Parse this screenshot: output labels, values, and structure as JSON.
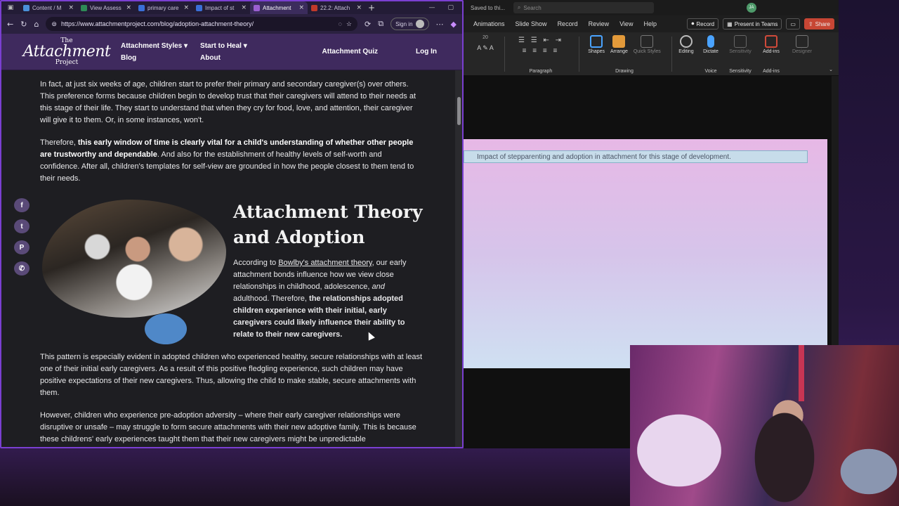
{
  "browser": {
    "tabs": [
      {
        "title": "Content / M",
        "color": "#4a90d9",
        "active": false
      },
      {
        "title": "View Assess",
        "color": "#2e8b57",
        "active": false
      },
      {
        "title": "primary care",
        "color": "#3a6fd8",
        "active": false
      },
      {
        "title": "Impact of st",
        "color": "#3a6fd8",
        "active": false
      },
      {
        "title": "Attachment",
        "color": "#9a5fd0",
        "active": true
      },
      {
        "title": "22.2: Attach",
        "color": "#c0392b",
        "active": false
      }
    ],
    "url": "https://www.attachmentproject.com/blog/adoption-attachment-theory/",
    "sign_in": "Sign in"
  },
  "site": {
    "logo": {
      "the": "The",
      "main": "Attachment",
      "sub": "Project"
    },
    "nav": {
      "attachment_styles": "Attachment Styles ▾",
      "start_to_heal": "Start to Heal ▾",
      "blog": "Blog",
      "about": "About",
      "quiz": "Attachment Quiz",
      "login": "Log In"
    }
  },
  "article": {
    "p1": "In fact, at just six weeks of age, children start to prefer their primary and secondary caregiver(s) over others. This preference forms because children begin to develop trust that their caregivers will attend to their needs at this stage of their life. They start to understand that when they cry for food, love, and attention, their caregiver will give it to them. Or, in some instances, won't.",
    "p2_pre": "Therefore, ",
    "p2_bold": "this early window of time is clearly vital for a child's understanding of whether other people are trustworthy and dependable",
    "p2_post": ". And also for the establishment of healthy levels of self-worth and confidence. After all, children's templates for self-view are grounded in how the people closest to them tend to their needs.",
    "heading": "Attachment Theory and Adoption",
    "side_pre": "According to ",
    "side_link": "Bowlby's attachment theory",
    "side_mid": ", our early attachment bonds influence how we view close relationships in childhood, adolescence, ",
    "side_em": "and",
    "side_mid2": " adulthood. Therefore, ",
    "side_bold": "the relationships adopted children experience with their initial, early caregivers could likely influence their ability to relate to their new caregivers.",
    "p3": "This pattern is especially evident in adopted children who experienced healthy, secure relationships with at least one of their initial early caregivers. As a result of this positive fledgling experience, such children may have positive expectations of their new caregivers. Thus, allowing the child to make stable, secure attachments with them.",
    "p4": "However, children who experience pre-adoption adversity – where their early caregiver relationships were disruptive or unsafe – may struggle to form secure attachments with their new adoptive family. This is because these childrens' early experiences taught them that their new caregivers might be unpredictable"
  },
  "social": [
    "f",
    "t",
    "p",
    "w"
  ],
  "ppt": {
    "saved": "Saved to thi...",
    "search_placeholder": "Search",
    "avatar": "JA",
    "menu": [
      "Animations",
      "Slide Show",
      "Record",
      "Review",
      "View",
      "Help"
    ],
    "record": "Record",
    "present_teams": "Present in Teams",
    "share": "Share",
    "groups": {
      "paragraph": "Paragraph",
      "drawing": "Drawing",
      "voice": "Voice",
      "sensitivity": "Sensitivity",
      "addins": "Add-ins"
    },
    "tools": {
      "shapes": "Shapes",
      "arrange": "Arrange",
      "quick_styles": "Quick Styles",
      "editing": "Editing",
      "dictate": "Dictate",
      "sensitivity": "Sensitivity",
      "addins": "Add-ins",
      "designer": "Designer"
    },
    "font_size": "20",
    "slide_title": "Impact of stepparenting and adoption in attachment for this stage of development."
  },
  "colors": {
    "browser_border": "#7a3fd1",
    "share": "#c74634",
    "slide_top": "#e7b8e6",
    "slide_bottom": "#cfe0f2"
  }
}
